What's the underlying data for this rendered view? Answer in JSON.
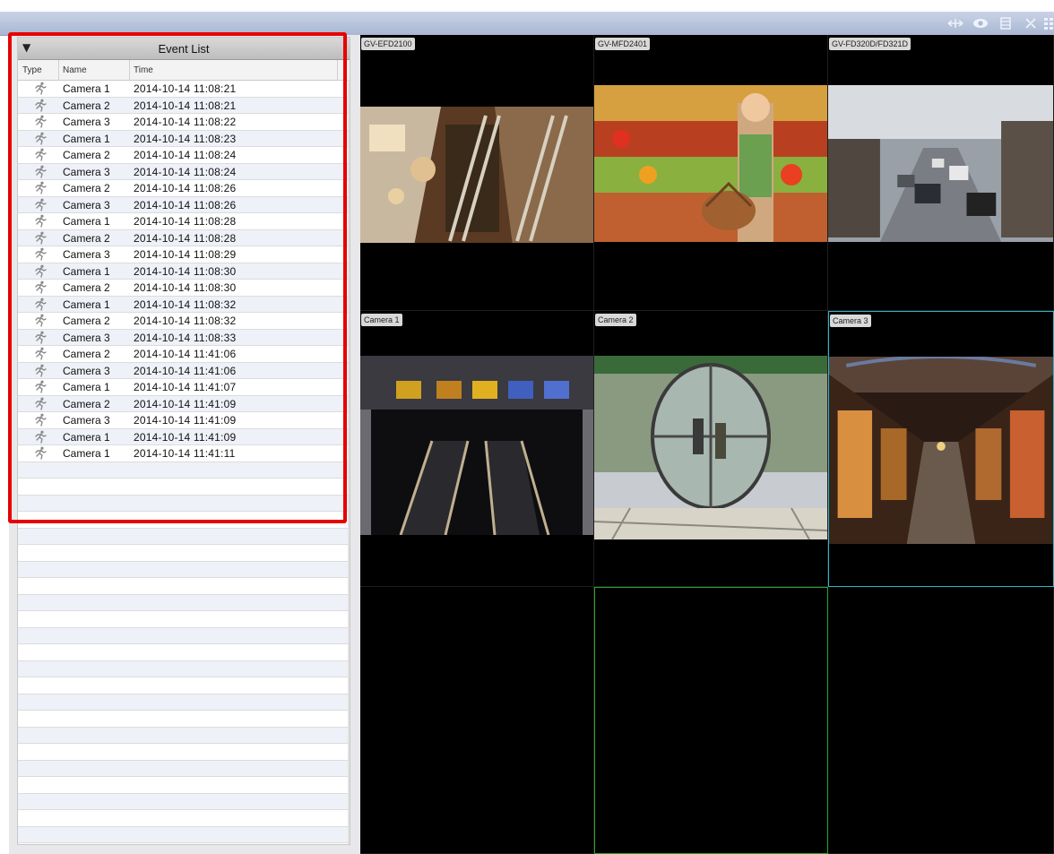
{
  "toolbar": {
    "icons": [
      "resize-arrows-icon",
      "eye-icon",
      "film-icon",
      "tools-icon",
      "grid-layout-icon"
    ]
  },
  "event_list": {
    "collapse_glyph": "▼",
    "title": "Event List",
    "columns": {
      "type": "Type",
      "name": "Name",
      "time": "Time"
    },
    "type_icon": "motion-runner-icon",
    "rows": [
      {
        "name": "Camera 1",
        "time": "2014-10-14 11:08:21"
      },
      {
        "name": "Camera 2",
        "time": "2014-10-14 11:08:21"
      },
      {
        "name": "Camera 3",
        "time": "2014-10-14 11:08:22"
      },
      {
        "name": "Camera 1",
        "time": "2014-10-14 11:08:23"
      },
      {
        "name": "Camera 2",
        "time": "2014-10-14 11:08:24"
      },
      {
        "name": "Camera 3",
        "time": "2014-10-14 11:08:24"
      },
      {
        "name": "Camera 2",
        "time": "2014-10-14 11:08:26"
      },
      {
        "name": "Camera 3",
        "time": "2014-10-14 11:08:26"
      },
      {
        "name": "Camera 1",
        "time": "2014-10-14 11:08:28"
      },
      {
        "name": "Camera 2",
        "time": "2014-10-14 11:08:28"
      },
      {
        "name": "Camera 3",
        "time": "2014-10-14 11:08:29"
      },
      {
        "name": "Camera 1",
        "time": "2014-10-14 11:08:30"
      },
      {
        "name": "Camera 2",
        "time": "2014-10-14 11:08:30"
      },
      {
        "name": "Camera 1",
        "time": "2014-10-14 11:08:32"
      },
      {
        "name": "Camera 2",
        "time": "2014-10-14 11:08:32"
      },
      {
        "name": "Camera 3",
        "time": "2014-10-14 11:08:33"
      },
      {
        "name": "Camera 2",
        "time": "2014-10-14 11:41:06"
      },
      {
        "name": "Camera 3",
        "time": "2014-10-14 11:41:06"
      },
      {
        "name": "Camera 1",
        "time": "2014-10-14 11:41:07"
      },
      {
        "name": "Camera 2",
        "time": "2014-10-14 11:41:09"
      },
      {
        "name": "Camera 3",
        "time": "2014-10-14 11:41:09"
      },
      {
        "name": "Camera 1",
        "time": "2014-10-14 11:41:09"
      },
      {
        "name": "Camera 1",
        "time": "2014-10-14 11:41:11"
      }
    ],
    "empty_rows": 23
  },
  "cameras": [
    {
      "label": "GV-EFD2100",
      "scene": "mall-escalators"
    },
    {
      "label": "GV-MFD2401",
      "scene": "grocery-shopper"
    },
    {
      "label": "GV-FD320D/FD321D",
      "scene": "city-street-traffic"
    },
    {
      "label": "Camera 1",
      "scene": "station-escalators"
    },
    {
      "label": "Camera 2",
      "scene": "revolving-door-lobby"
    },
    {
      "label": "Camera 3",
      "scene": "shopping-arcade"
    },
    {
      "label": "",
      "scene": "empty"
    },
    {
      "label": "",
      "scene": "empty"
    },
    {
      "label": "",
      "scene": "empty"
    }
  ],
  "colors": {
    "highlight": "#e60000",
    "selected_cyan": "#2fb7c8",
    "selected_green": "#2aa52a"
  }
}
